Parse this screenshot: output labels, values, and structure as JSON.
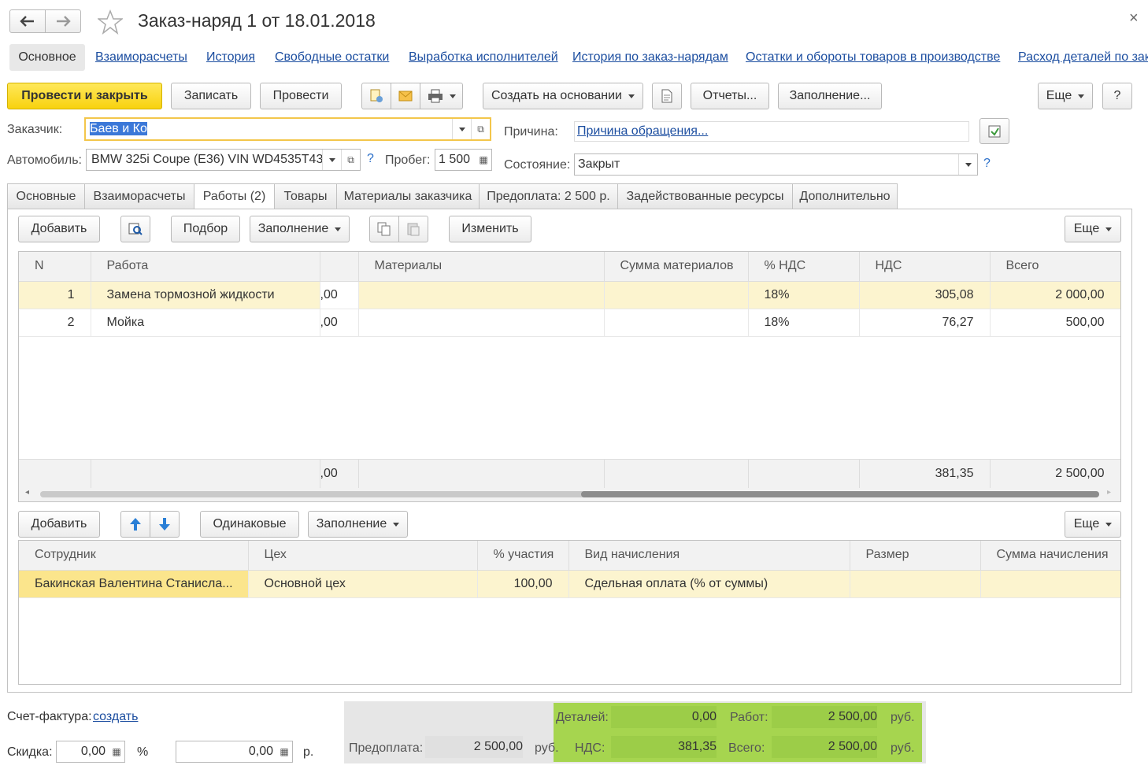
{
  "window": {
    "title": "Заказ-наряд 1 от 18.01.2018"
  },
  "nav_tabs": [
    "Основное",
    "Взаиморасчеты",
    "История",
    "Свободные остатки",
    "Выработка исполнителей",
    "История по заказ-нарядам",
    "Остатки и обороты товаров в производстве",
    "Расход деталей по зака"
  ],
  "toolbar": {
    "post_close": "Провести и закрыть",
    "save": "Записать",
    "post": "Провести",
    "create_based": "Создать на основании",
    "reports": "Отчеты...",
    "fill": "Заполнение...",
    "more": "Еще",
    "help": "?"
  },
  "header": {
    "customer_label": "Заказчик:",
    "customer_value": "Баев и Ко",
    "car_label": "Автомобиль:",
    "car_value": "BMW 325i Coupe (E36) VIN WD4535T43",
    "mileage_label": "Пробег:",
    "mileage_value": "1 500",
    "reason_label": "Причина:",
    "reason_value": "Причина обращения...",
    "state_label": "Состояние:",
    "state_value": "Закрыт",
    "help_mark": "?"
  },
  "doc_tabs": [
    "Основные",
    "Взаиморасчеты",
    "Работы (2)",
    "Товары",
    "Материалы заказчика",
    "Предоплата: 2 500 р.",
    "Задействованные ресурсы",
    "Дополнительно"
  ],
  "works_toolbar": {
    "add": "Добавить",
    "pick": "Подбор",
    "fill": "Заполнение",
    "edit": "Изменить",
    "more": "Еще"
  },
  "works_table": {
    "columns": [
      "N",
      "Работа",
      "",
      "Материалы",
      "Сумма материалов",
      "% НДС",
      "НДС",
      "Всего"
    ],
    "rows": [
      [
        "1",
        "Замена тормозной жидкости",
        ",00",
        "",
        "",
        "18%",
        "305,08",
        "2 000,00"
      ],
      [
        "2",
        "Мойка",
        ",00",
        "",
        "",
        "18%",
        "76,27",
        "500,00"
      ]
    ],
    "footer": [
      "",
      "",
      ",00",
      "",
      "",
      "",
      "381,35",
      "2 500,00"
    ]
  },
  "staff_toolbar": {
    "add": "Добавить",
    "same": "Одинаковые",
    "fill": "Заполнение",
    "more": "Еще"
  },
  "staff_table": {
    "columns": [
      "Сотрудник",
      "Цех",
      "% участия",
      "Вид начисления",
      "Размер",
      "Сумма начисления"
    ],
    "rows": [
      [
        "Бакинская Валентина Станисла...",
        "Основной цех",
        "100,00",
        "Сдельная оплата (% от суммы)",
        "",
        ""
      ]
    ]
  },
  "bottom": {
    "invoice_label": "Счет-фактура:",
    "invoice_link": "создать",
    "discount_label": "Скидка:",
    "discount_pct": "0,00",
    "pct_sign": "%",
    "discount_sum": "0,00",
    "rub_short": "р.",
    "prepay_label": "Предоплата:",
    "prepay_value": "2 500,00",
    "rub": "руб.",
    "details_label": "Деталей:",
    "details_value": "0,00",
    "works_label": "Работ:",
    "works_value": "2 500,00",
    "vat_label": "НДС:",
    "vat_value": "381,35",
    "total_label": "Всего:",
    "total_value": "2 500,00"
  }
}
